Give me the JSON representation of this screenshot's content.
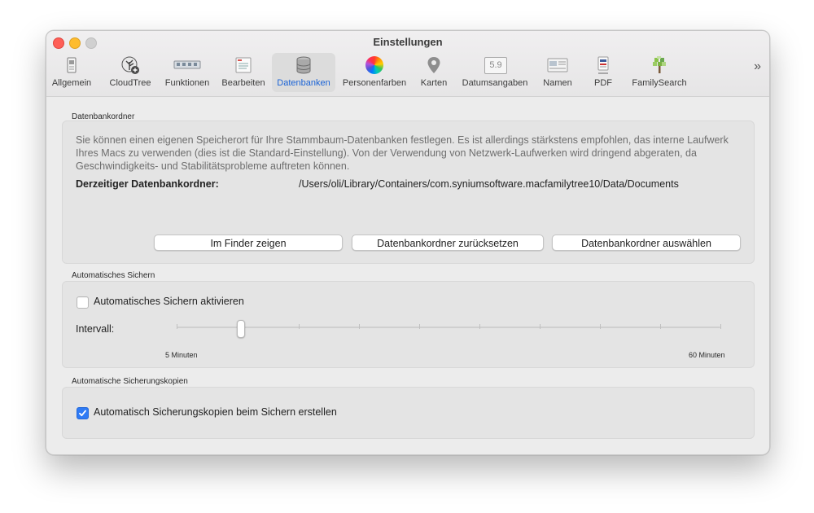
{
  "window": {
    "title": "Einstellungen"
  },
  "toolbar": {
    "items": [
      {
        "label": "Allgemein",
        "icon": "general-settings-icon"
      },
      {
        "label": "CloudTree",
        "icon": "cloudtree-icon"
      },
      {
        "label": "Funktionen",
        "icon": "functions-icon"
      },
      {
        "label": "Bearbeiten",
        "icon": "edit-icon"
      },
      {
        "label": "Datenbanken",
        "icon": "database-icon",
        "selected": true
      },
      {
        "label": "Personenfarben",
        "icon": "color-wheel-icon"
      },
      {
        "label": "Karten",
        "icon": "map-pin-icon"
      },
      {
        "label": "Datumsangaben",
        "icon": "date-icon"
      },
      {
        "label": "Namen",
        "icon": "names-icon"
      },
      {
        "label": "PDF",
        "icon": "pdf-icon"
      },
      {
        "label": "FamilySearch",
        "icon": "familysearch-tree-icon"
      }
    ],
    "more": "»",
    "date_icon_text": "5.9"
  },
  "folder_section": {
    "title": "Datenbankordner",
    "description": "Sie können einen eigenen Speicherort für Ihre Stammbaum-Datenbanken festlegen. Es ist allerdings stärkstens empfohlen, das interne Laufwerk Ihres Macs zu verwenden (dies ist die Standard-Einstellung). Von der Verwendung von Netzwerk-Laufwerken wird dringend abgeraten, da Geschwindigkeits- und Stabilitätsprobleme auftreten können.",
    "current_label": "Derzeitiger Datenbankordner:",
    "current_path": "/Users/oli/Library/Containers/com.syniumsoftware.macfamilytree10/Data/Documents",
    "buttons": {
      "show_in_finder": "Im Finder zeigen",
      "reset": "Datenbankordner zurücksetzen",
      "choose": "Datenbankordner auswählen"
    }
  },
  "autosave_section": {
    "title": "Automatisches Sichern",
    "checkbox_label": "Automatisches Sichern aktivieren",
    "checkbox_checked": false,
    "interval_label": "Intervall:",
    "min_label": "5 Minuten",
    "max_label": "60 Minuten",
    "slider_value_fraction": 0.12
  },
  "backup_section": {
    "title": "Automatische Sicherungskopien",
    "checkbox_label": "Automatisch Sicherungskopien beim Sichern erstellen",
    "checkbox_checked": true
  },
  "colors": {
    "accent": "#2f7bf5",
    "close": "#fe5f57",
    "minimize": "#febc2e"
  }
}
